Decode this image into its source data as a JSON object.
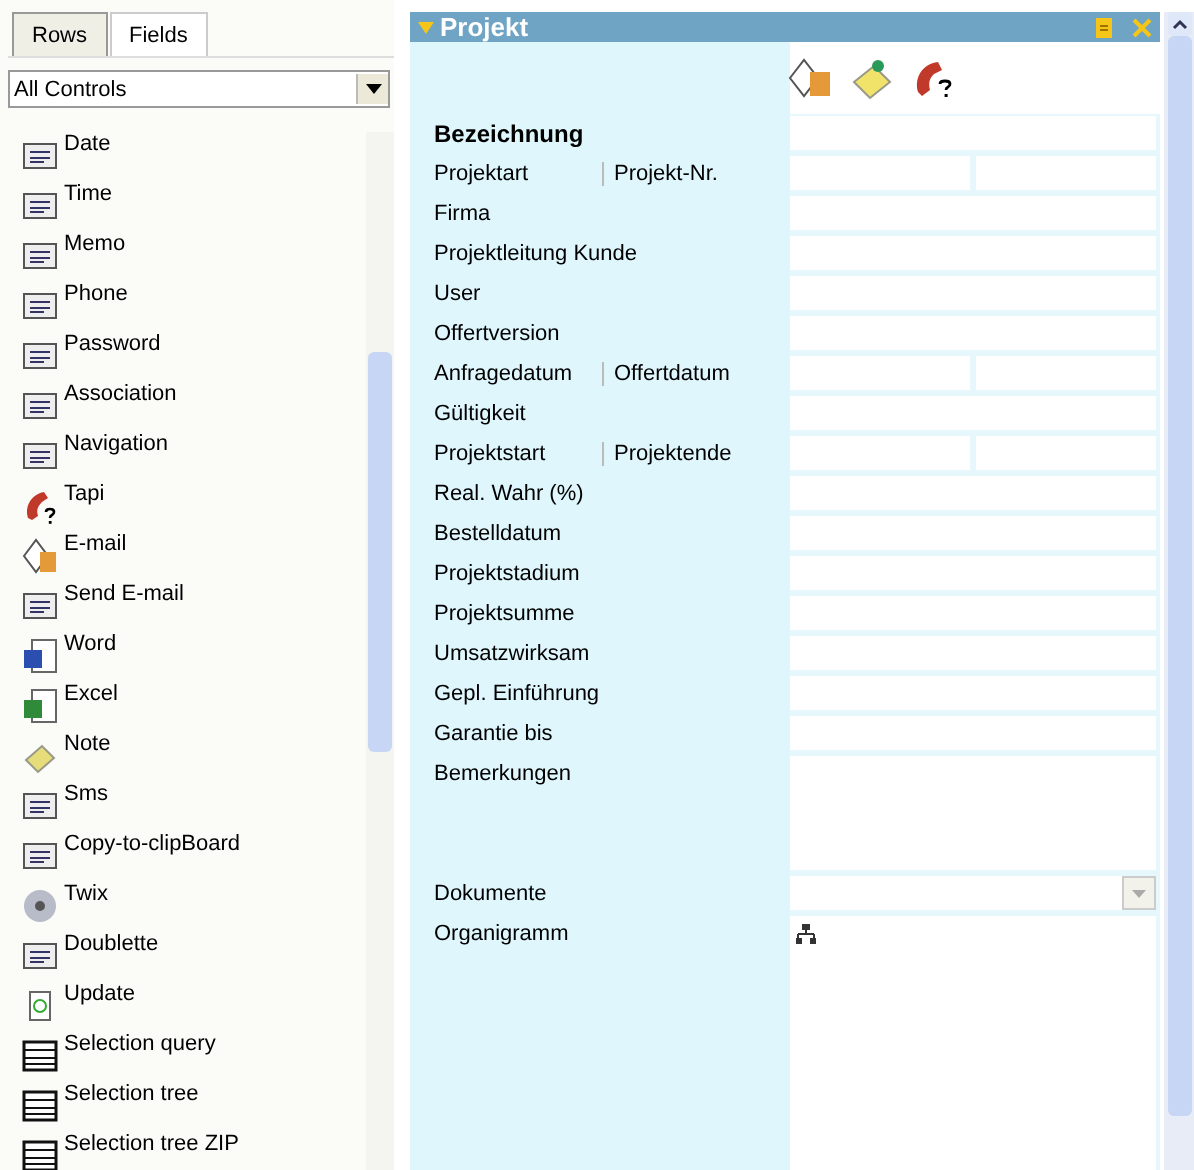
{
  "tabs": [
    {
      "label": "Rows",
      "selected": true
    },
    {
      "label": "Fields",
      "selected": false
    }
  ],
  "filter": {
    "value": "All Controls"
  },
  "controls": [
    {
      "label": "Date"
    },
    {
      "label": "Time"
    },
    {
      "label": "Memo"
    },
    {
      "label": "Phone"
    },
    {
      "label": "Password"
    },
    {
      "label": "Association"
    },
    {
      "label": "Navigation"
    },
    {
      "label": "Tapi"
    },
    {
      "label": "E-mail"
    },
    {
      "label": "Send E-mail"
    },
    {
      "label": "Word"
    },
    {
      "label": "Excel"
    },
    {
      "label": "Note"
    },
    {
      "label": "Sms"
    },
    {
      "label": "Copy-to-clipBoard"
    },
    {
      "label": "Twix"
    },
    {
      "label": "Doublette"
    },
    {
      "label": "Update"
    },
    {
      "label": "Selection query"
    },
    {
      "label": "Selection tree"
    },
    {
      "label": "Selection tree ZIP"
    }
  ],
  "panel": {
    "title": "Projekt",
    "expanded": true
  },
  "form": [
    {
      "kind": "bold",
      "label": "Bezeichnung"
    },
    {
      "kind": "split",
      "label": "Projektart",
      "label2": "Projekt-Nr."
    },
    {
      "kind": "single",
      "label": "Firma"
    },
    {
      "kind": "single",
      "label": "Projektleitung Kunde"
    },
    {
      "kind": "single",
      "label": "User"
    },
    {
      "kind": "single",
      "label": "Offertversion"
    },
    {
      "kind": "split",
      "label": "Anfragedatum",
      "label2": "Offertdatum"
    },
    {
      "kind": "single",
      "label": "Gültigkeit"
    },
    {
      "kind": "split",
      "label": "Projektstart",
      "label2": "Projektende"
    },
    {
      "kind": "single",
      "label": "Real. Wahr (%)"
    },
    {
      "kind": "single",
      "label": "Bestelldatum"
    },
    {
      "kind": "single",
      "label": "Projektstadium"
    },
    {
      "kind": "single",
      "label": "Projektsumme"
    },
    {
      "kind": "single",
      "label": "Umsatzwirksam"
    },
    {
      "kind": "single",
      "label": "Gepl. Einführung"
    },
    {
      "kind": "single",
      "label": "Garantie bis"
    },
    {
      "kind": "memo",
      "label": "Bemerkungen"
    },
    {
      "kind": "dropdown",
      "label": "Dokumente"
    },
    {
      "kind": "org",
      "label": "Organigramm"
    }
  ]
}
